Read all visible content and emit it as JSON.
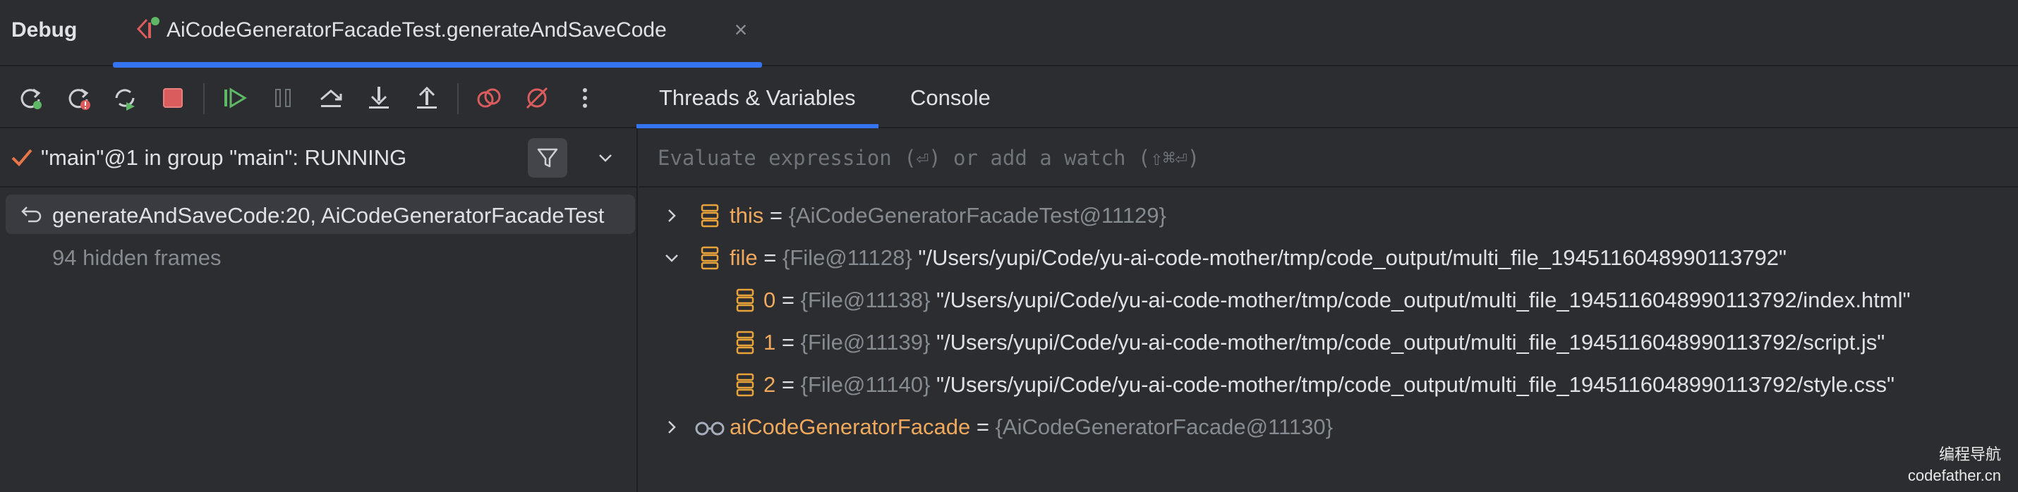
{
  "header": {
    "title": "Debug",
    "session_tab": "AiCodeGeneratorFacadeTest.generateAndSaveCode"
  },
  "toolbar": {
    "buttons": [
      "rerun",
      "rerun-failed",
      "restart",
      "stop",
      "resume",
      "pause",
      "step-over",
      "step-into",
      "step-out",
      "view-breakpoints",
      "mute-breakpoints",
      "more"
    ],
    "tabs": [
      "Threads & Variables",
      "Console"
    ],
    "active_tab": "Threads & Variables"
  },
  "threads": {
    "current_thread": "\"main\"@1 in group \"main\": RUNNING",
    "frames": [
      {
        "label": "generateAndSaveCode:20, AiCodeGeneratorFacadeTest"
      }
    ],
    "hidden_frames": "94 hidden frames"
  },
  "evaluate": {
    "placeholder": "Evaluate expression (⏎) or add a watch (⇧⌘⏎)"
  },
  "variables": [
    {
      "name": "this",
      "type": "{AiCodeGeneratorFacadeTest@11129}",
      "value": "",
      "expanded": false,
      "icon": "field-icon"
    },
    {
      "name": "file",
      "type": "{File@11128}",
      "value": "\"/Users/yupi/Code/yu-ai-code-mother/tmp/code_output/multi_file_1945116048990113792\"",
      "expanded": true,
      "icon": "field-icon"
    },
    {
      "name": "0",
      "type": "{File@11138}",
      "value": "\"/Users/yupi/Code/yu-ai-code-mother/tmp/code_output/multi_file_1945116048990113792/index.html\"",
      "icon": "field-icon"
    },
    {
      "name": "1",
      "type": "{File@11139}",
      "value": "\"/Users/yupi/Code/yu-ai-code-mother/tmp/code_output/multi_file_1945116048990113792/script.js\"",
      "icon": "field-icon"
    },
    {
      "name": "2",
      "type": "{File@11140}",
      "value": "\"/Users/yupi/Code/yu-ai-code-mother/tmp/code_output/multi_file_1945116048990113792/style.css\"",
      "icon": "field-icon"
    },
    {
      "name": "aiCodeGeneratorFacade",
      "type": "{AiCodeGeneratorFacade@11130}",
      "value": "",
      "expanded": false,
      "icon": "watch-glasses-icon"
    }
  ],
  "watermark": {
    "line1": "编程导航",
    "line2": "codefather.cn"
  },
  "colors": {
    "accent": "#3574f0",
    "var_name": "#f0a95c",
    "type_gray": "#868a91",
    "stop_red": "#db5c5c",
    "resume_green": "#5fb865"
  }
}
